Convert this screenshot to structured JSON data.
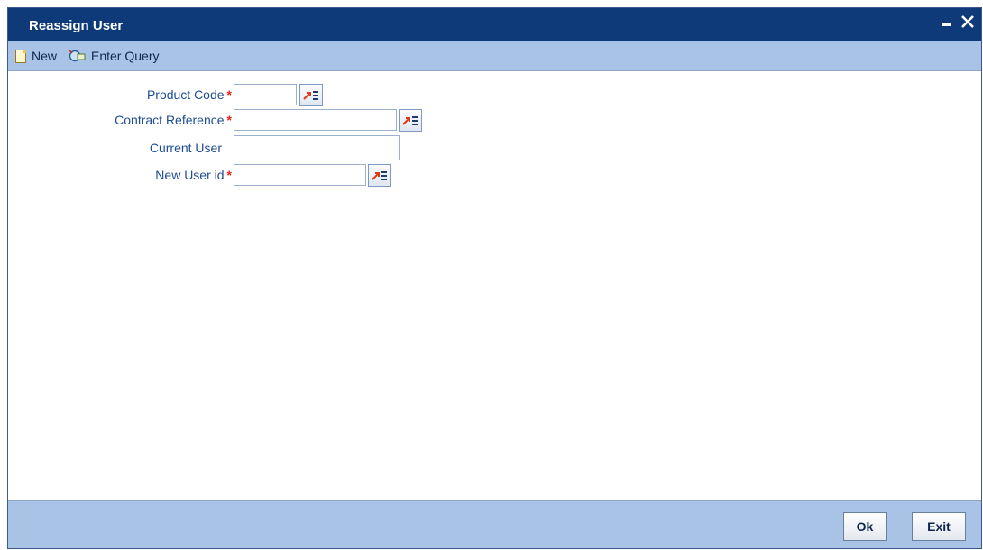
{
  "window": {
    "title": "Reassign User",
    "minimize_glyph": "▁",
    "close_glyph": "✕"
  },
  "toolbar": {
    "new_label": "New",
    "enter_query_label": "Enter Query",
    "icons": [
      "new-document-icon",
      "enter-query-icon"
    ]
  },
  "form": {
    "fields": [
      {
        "label": "Product Code",
        "required": true,
        "value": ""
      },
      {
        "label": "Contract Reference",
        "required": true,
        "value": ""
      },
      {
        "label": "Current User",
        "required": false,
        "value": ""
      },
      {
        "label": "New User id",
        "required": true,
        "value": ""
      }
    ],
    "required_marker": "*"
  },
  "footer": {
    "ok_label": "Ok",
    "exit_label": "Exit"
  },
  "colors": {
    "titlebar": "#0e3a7a",
    "toolbar": "#a9c3e6",
    "label_text": "#1f4d94",
    "required_marker": "#e0261a"
  }
}
